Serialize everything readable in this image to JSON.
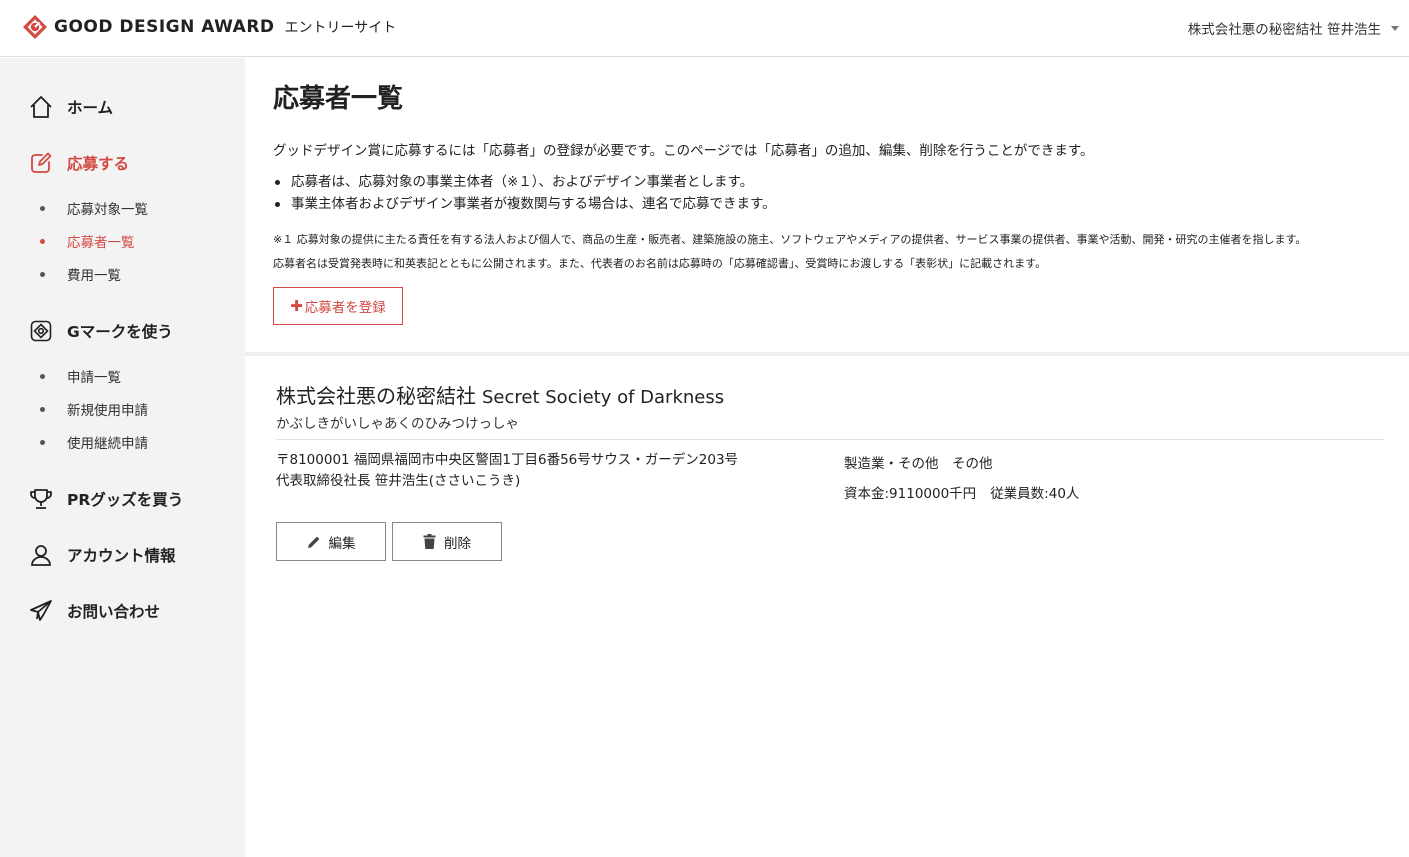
{
  "header": {
    "logo_text": "GOOD DESIGN AWARD",
    "logo_sub": "エントリーサイト",
    "user_name": "株式会社悪の秘密結社 笹井浩生",
    "accent_color": "#d24a43"
  },
  "sidebar": {
    "home": "ホーム",
    "apply": "応募する",
    "apply_items": [
      "応募対象一覧",
      "応募者一覧",
      "費用一覧"
    ],
    "gmark": "Gマークを使う",
    "gmark_items": [
      "申請一覧",
      "新規使用申請",
      "使用継続申請"
    ],
    "goods": "PRグッズを買う",
    "account": "アカウント情報",
    "contact": "お問い合わせ"
  },
  "main": {
    "title": "応募者一覧",
    "intro": "グッドデザイン賞に応募するには「応募者」の登録が必要です。このページでは「応募者」の追加、編集、削除を行うことができます。",
    "bullets": [
      "応募者は、応募対象の事業主体者（※１）、およびデザイン事業者とします。",
      "事業主体者およびデザイン事業者が複数関与する場合は、連名で応募できます。"
    ],
    "note1": "※１ 応募対象の提供に主たる責任を有する法人および個人で、商品の生産・販売者、建築施設の施主、ソフトウェアやメディアの提供者、サービス事業の提供者、事業や活動、開発・研究の主催者を指します。",
    "note2": "応募者名は受賞発表時に和英表記とともに公開されます。また、代表者のお名前は応募時の「応募確認書」、受賞時にお渡しする「表彰状」に記載されます。",
    "register_button": "応募者を登録"
  },
  "applicant": {
    "name_ja": "株式会社悪の秘密結社",
    "name_en": "Secret Society of Darkness",
    "kana": "かぶしきがいしゃあくのひみつけっしゃ",
    "address": "〒8100001 福岡県福岡市中央区警固1丁目6番56号サウス・ガーデン203号",
    "representative": "代表取締役社長 笹井浩生(ささいこうき)",
    "industry": "製造業・その他　その他",
    "capital": "資本金:9110000千円",
    "employees": "従業員数:40人",
    "edit_button": "編集",
    "delete_button": "削除"
  }
}
